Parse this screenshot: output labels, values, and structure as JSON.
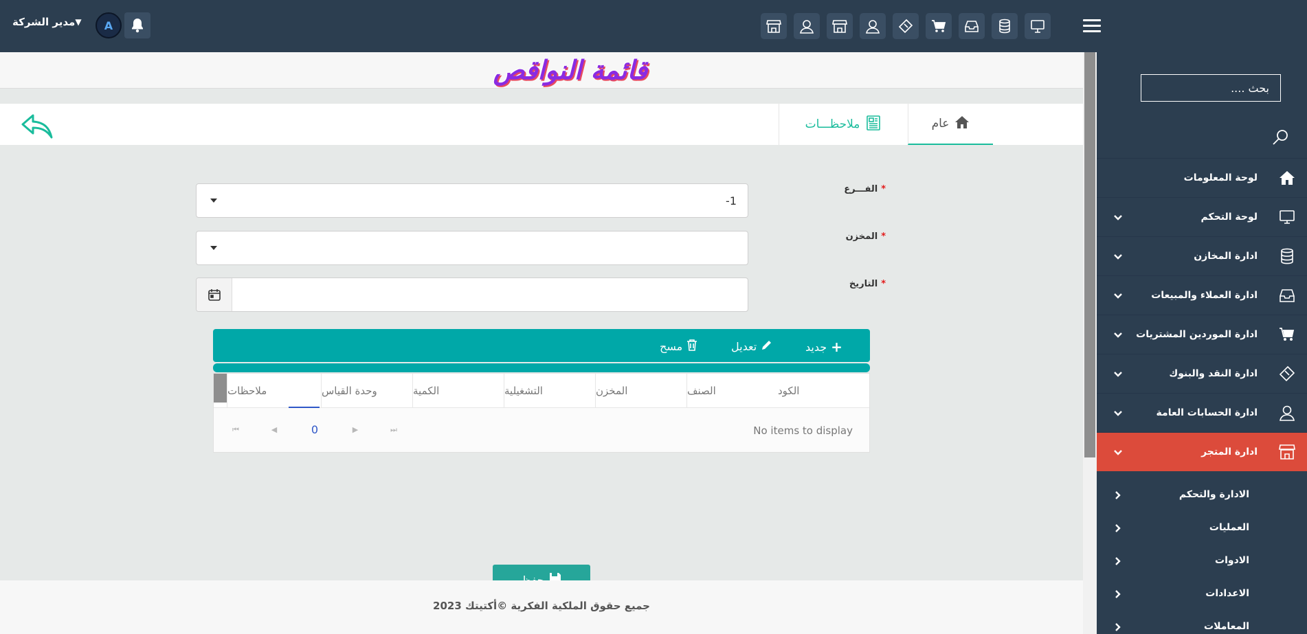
{
  "header": {
    "user_name": "مدير الشركة",
    "quick_icons": [
      "store-icon",
      "user-icon",
      "store-icon",
      "user-icon",
      "ticket-icon",
      "cart-icon",
      "inbox-icon",
      "database-icon",
      "monitor-icon"
    ]
  },
  "sidebar": {
    "search_placeholder": "بحث ....",
    "items": [
      {
        "label": "لوحة المعلومات",
        "icon": "home-icon",
        "has_arrow": false
      },
      {
        "label": "لوحة التحكم",
        "icon": "monitor-icon",
        "has_arrow": true
      },
      {
        "label": "ادارة المخازن",
        "icon": "database-icon",
        "has_arrow": true
      },
      {
        "label": "ادارة العملاء والمبيعات",
        "icon": "inbox-icon",
        "has_arrow": true
      },
      {
        "label": "ادارة الموردين المشتريات",
        "icon": "cart-icon",
        "has_arrow": true
      },
      {
        "label": "ادارة النقد والبنوك",
        "icon": "ticket-icon",
        "has_arrow": true
      },
      {
        "label": "ادارة الحسابات العامة",
        "icon": "user-icon",
        "has_arrow": true
      },
      {
        "label": "ادارة المتجر",
        "icon": "store-icon",
        "has_arrow": true,
        "active": true
      }
    ],
    "subitems": [
      "الادارة والتحكم",
      "العمليات",
      "الادوات",
      "الاعدادات",
      "المعاملات"
    ],
    "active_color": "#dc4b3b"
  },
  "page": {
    "title": "قائمة النواقص"
  },
  "tabs": {
    "general": "عام",
    "notes": "ملاحظـــات"
  },
  "form": {
    "branch_label": "الفـــرع",
    "branch_value": "-1",
    "store_label": "المخزن",
    "store_value": "",
    "date_label": "التاريخ",
    "date_value": "",
    "required_mark": "*"
  },
  "toolbar": {
    "new_label": "جديد",
    "edit_label": "تعديل",
    "delete_label": "مسح",
    "accent": "#00a8a8"
  },
  "grid": {
    "columns": [
      "الكود",
      "الصنف",
      "المخزن",
      "التشغيلية",
      "الكمية",
      "وحدة القياس",
      "ملاحظات"
    ],
    "empty_text": "No items to display",
    "page": "0"
  },
  "save_label": "حفظ",
  "footer": {
    "copyright": "جميع حقوق الملكية الفكرية ©أكتيتك 2023"
  }
}
